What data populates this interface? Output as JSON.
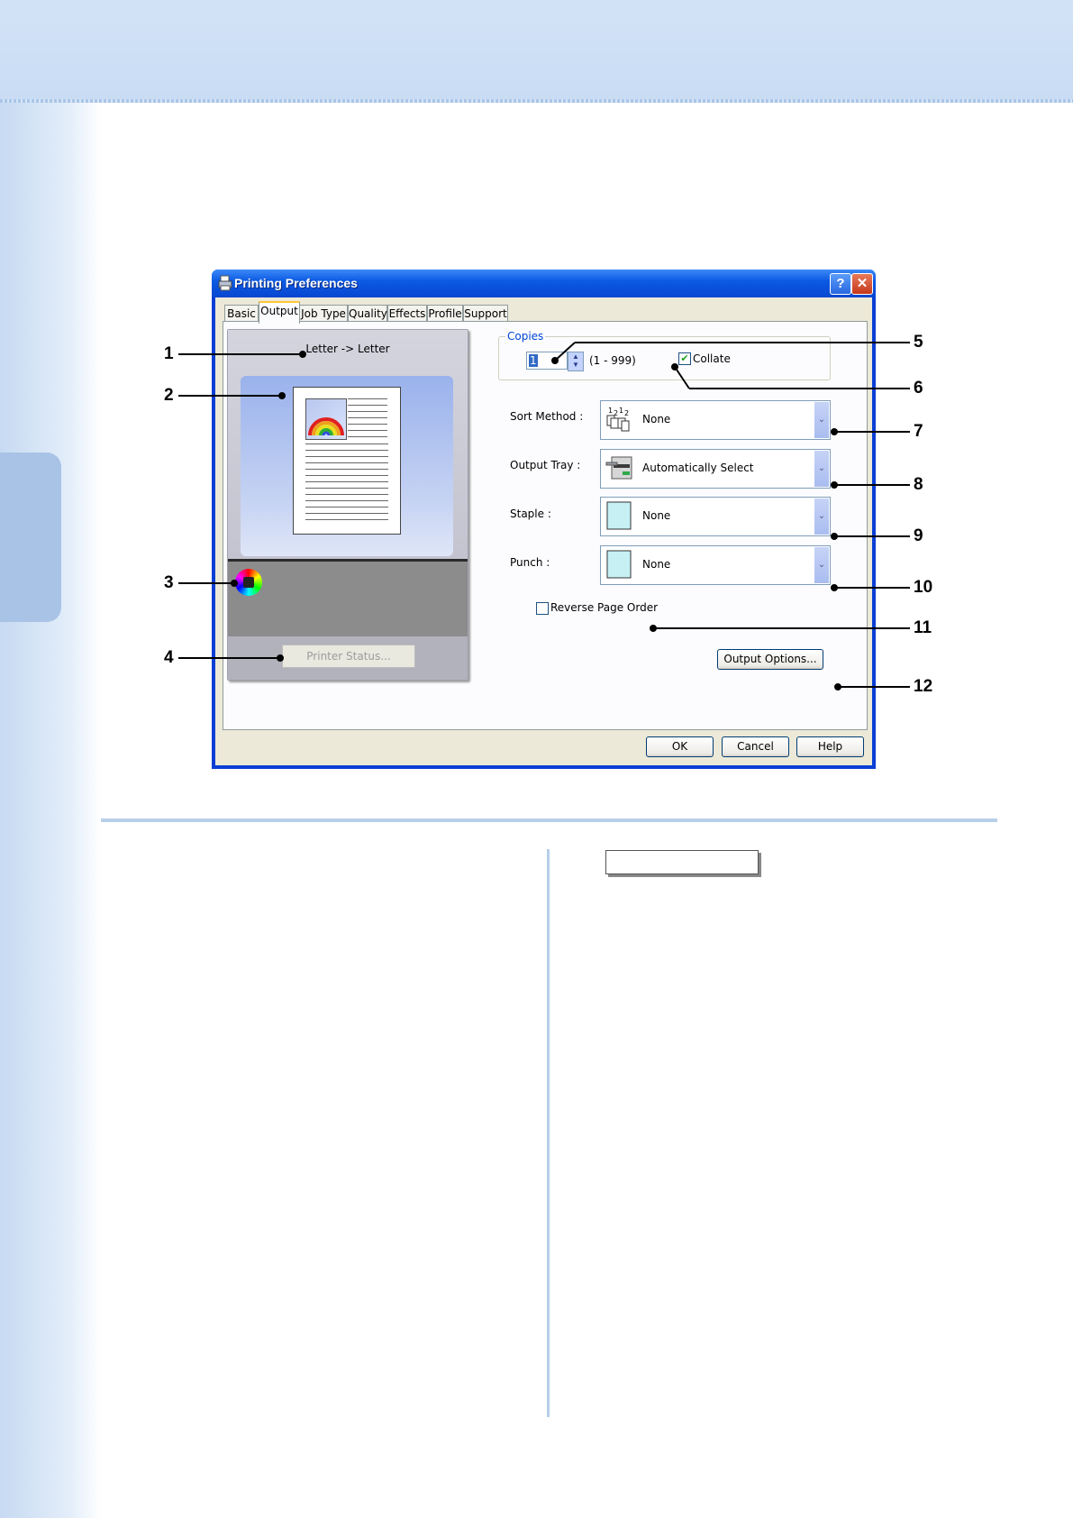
{
  "window": {
    "title": "Printing Preferences",
    "help_glyph": "?",
    "close_glyph": "✕"
  },
  "tabs": [
    "Basic",
    "Output",
    "Job Type",
    "Quality",
    "Effects",
    "Profile",
    "Support"
  ],
  "active_tab": "Output",
  "preview": {
    "paper_label": "Letter -> Letter",
    "printer_status_button": "Printer Status..."
  },
  "copies": {
    "legend": "Copies",
    "value": "1",
    "range": "(1 - 999)",
    "collate_label": "Collate",
    "collate_checked": true
  },
  "fields": {
    "sort_method": {
      "label": "Sort Method :",
      "value": "None"
    },
    "output_tray": {
      "label": "Output Tray :",
      "value": "Automatically Select"
    },
    "staple": {
      "label": "Staple :",
      "value": "None"
    },
    "punch": {
      "label": "Punch :",
      "value": "None"
    }
  },
  "reverse_page_order": {
    "label": "Reverse Page Order",
    "checked": false
  },
  "buttons": {
    "output_options": "Output Options...",
    "ok": "OK",
    "cancel": "Cancel",
    "help": "Help"
  },
  "callouts": [
    "1",
    "2",
    "3",
    "4",
    "5",
    "6",
    "7",
    "8",
    "9",
    "10",
    "11",
    "12"
  ],
  "colors": {
    "titlebar": "#0846d1",
    "dialog_face": "#ece9d8",
    "page_band": "#d2e3f7",
    "rule": "#b7cfe8"
  }
}
